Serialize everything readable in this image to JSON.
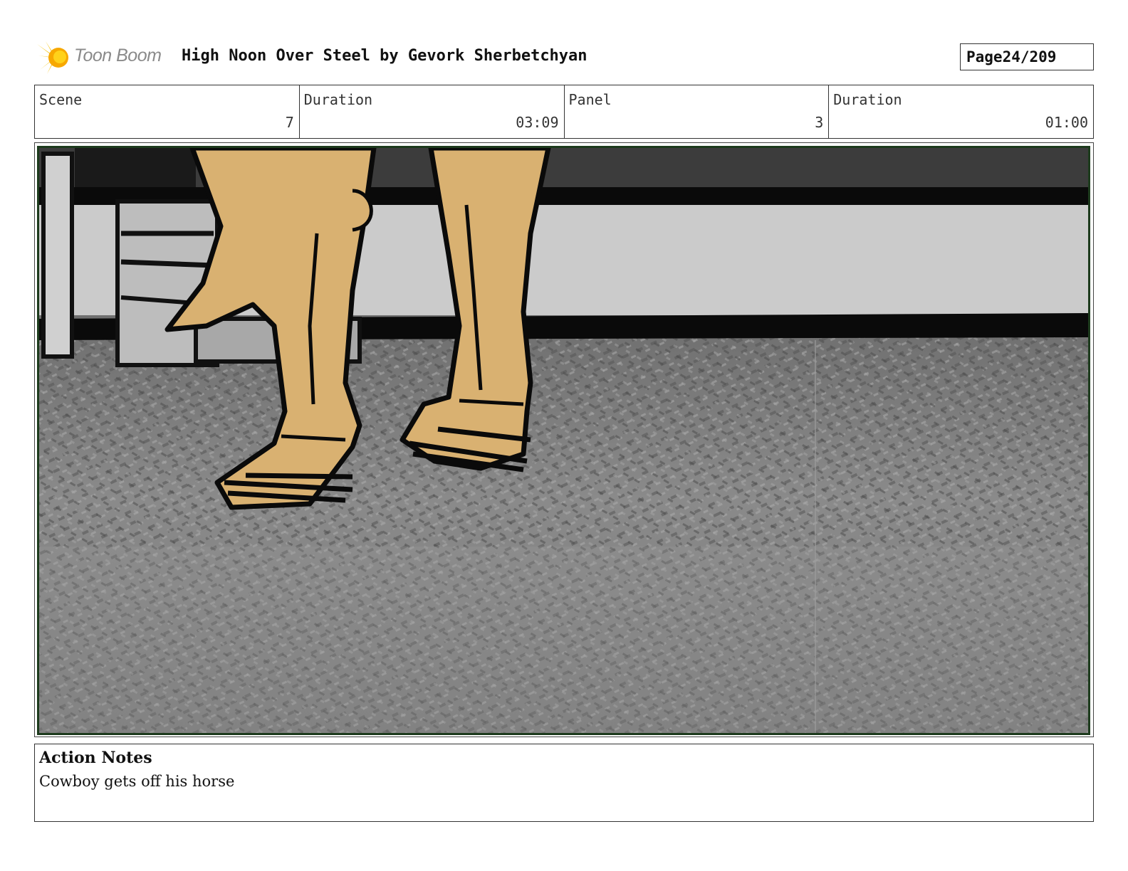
{
  "header": {
    "logo_text": "Toon Boom",
    "title": "High Noon Over Steel by Gevork Sherbetchyan",
    "page_label": "Page",
    "page_number": "24/209"
  },
  "info": {
    "scene_label": "Scene",
    "scene_value": "7",
    "scene_duration_label": "Duration",
    "scene_duration_value": "03:09",
    "panel_label": "Panel",
    "panel_value": "3",
    "panel_duration_label": "Duration",
    "panel_duration_value": "01:00"
  },
  "panel": {
    "skin_color": "#d9b171",
    "frame_color": "#1d3b1d"
  },
  "notes": {
    "heading": "Action Notes",
    "text": "Cowboy gets off his horse"
  }
}
